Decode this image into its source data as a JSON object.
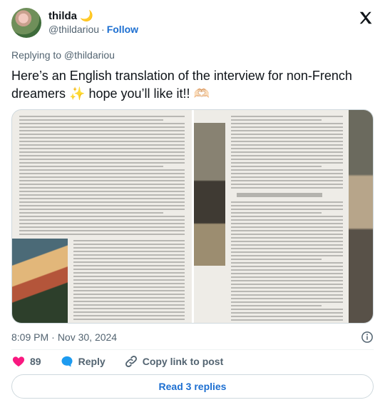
{
  "author": {
    "display_name": "thilda",
    "name_emoji": "🌙",
    "handle": "@thildariou",
    "follow_label": "Follow"
  },
  "icons": {
    "brand": "x-logo-icon",
    "info": "info-icon",
    "like": "heart-icon",
    "reply": "reply-bubble-icon",
    "copy": "link-icon"
  },
  "tweet": {
    "replying_to": "Replying to @thildariou",
    "text": "Here’s an English translation of the interview for non-French dreamers ✨ hope you’ll like it!! 🫶🏻",
    "time": "8:09 PM",
    "separator": "·",
    "date": "Nov 30, 2024"
  },
  "actions": {
    "like_count": "89",
    "reply_label": "Reply",
    "copy_label": "Copy link to post"
  },
  "read_replies_label": "Read 3 replies",
  "colors": {
    "accent": "#1d6fd1",
    "like": "#f91880",
    "muted": "#536471",
    "text": "#0f1419"
  }
}
